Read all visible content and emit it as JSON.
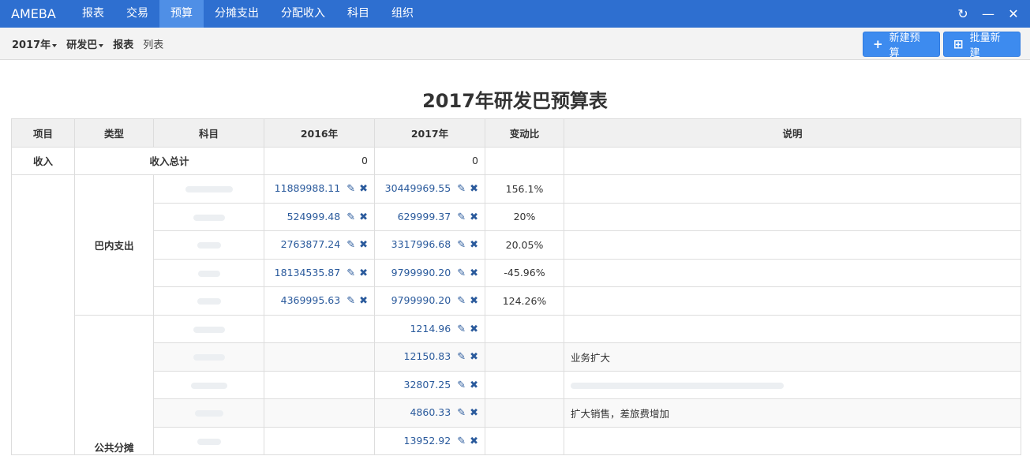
{
  "app": {
    "brand": "AMEBA"
  },
  "nav": {
    "items": [
      {
        "label": "报表"
      },
      {
        "label": "交易"
      },
      {
        "label": "预算"
      },
      {
        "label": "分摊支出"
      },
      {
        "label": "分配收入"
      },
      {
        "label": "科目"
      },
      {
        "label": "组织"
      }
    ],
    "active_index": 2,
    "refresh_icon": "↻",
    "minimize_icon": "—",
    "close_icon": "✕"
  },
  "toolbar": {
    "year": "2017年",
    "org": "研发巴",
    "report": "报表",
    "list": "列表",
    "new_budget_label": "新建预算",
    "batch_new_label": "批量新建",
    "new_budget_icon": "+",
    "batch_new_icon": "⊞"
  },
  "page_title": "2017年研发巴预算表",
  "table": {
    "headers": [
      "项目",
      "类型",
      "科目",
      "2016年",
      "2017年",
      "变动比",
      "说明"
    ],
    "income_row": {
      "project": "收入",
      "label": "收入总计",
      "y2016": "0",
      "y2017": "0"
    },
    "groups": [
      {
        "type": "巴内支出",
        "rows": [
          {
            "y2016": "11889988.11",
            "y2017": "30449969.55",
            "change": "156.1%",
            "note": ""
          },
          {
            "y2016": "524999.48",
            "y2017": "629999.37",
            "change": "20%",
            "note": ""
          },
          {
            "y2016": "2763877.24",
            "y2017": "3317996.68",
            "change": "20.05%",
            "note": ""
          },
          {
            "y2016": "18134535.87",
            "y2017": "9799990.20",
            "change": "-45.96%",
            "note": ""
          },
          {
            "y2016": "4369995.63",
            "y2017": "9799990.20",
            "change": "124.26%",
            "note": ""
          }
        ]
      },
      {
        "type": "公共分摊",
        "rows": [
          {
            "y2016": "",
            "y2017": "1214.96",
            "change": "",
            "note": ""
          },
          {
            "y2016": "",
            "y2017": "12150.83",
            "change": "",
            "note": "业务扩大"
          },
          {
            "y2016": "",
            "y2017": "32807.25",
            "change": "",
            "note": ""
          },
          {
            "y2016": "",
            "y2017": "4860.33",
            "change": "",
            "note": "扩大销售，差旅费增加"
          },
          {
            "y2016": "",
            "y2017": "13952.92",
            "change": "",
            "note": ""
          }
        ]
      }
    ],
    "edit_icon": "✎",
    "delete_icon": "✖"
  }
}
